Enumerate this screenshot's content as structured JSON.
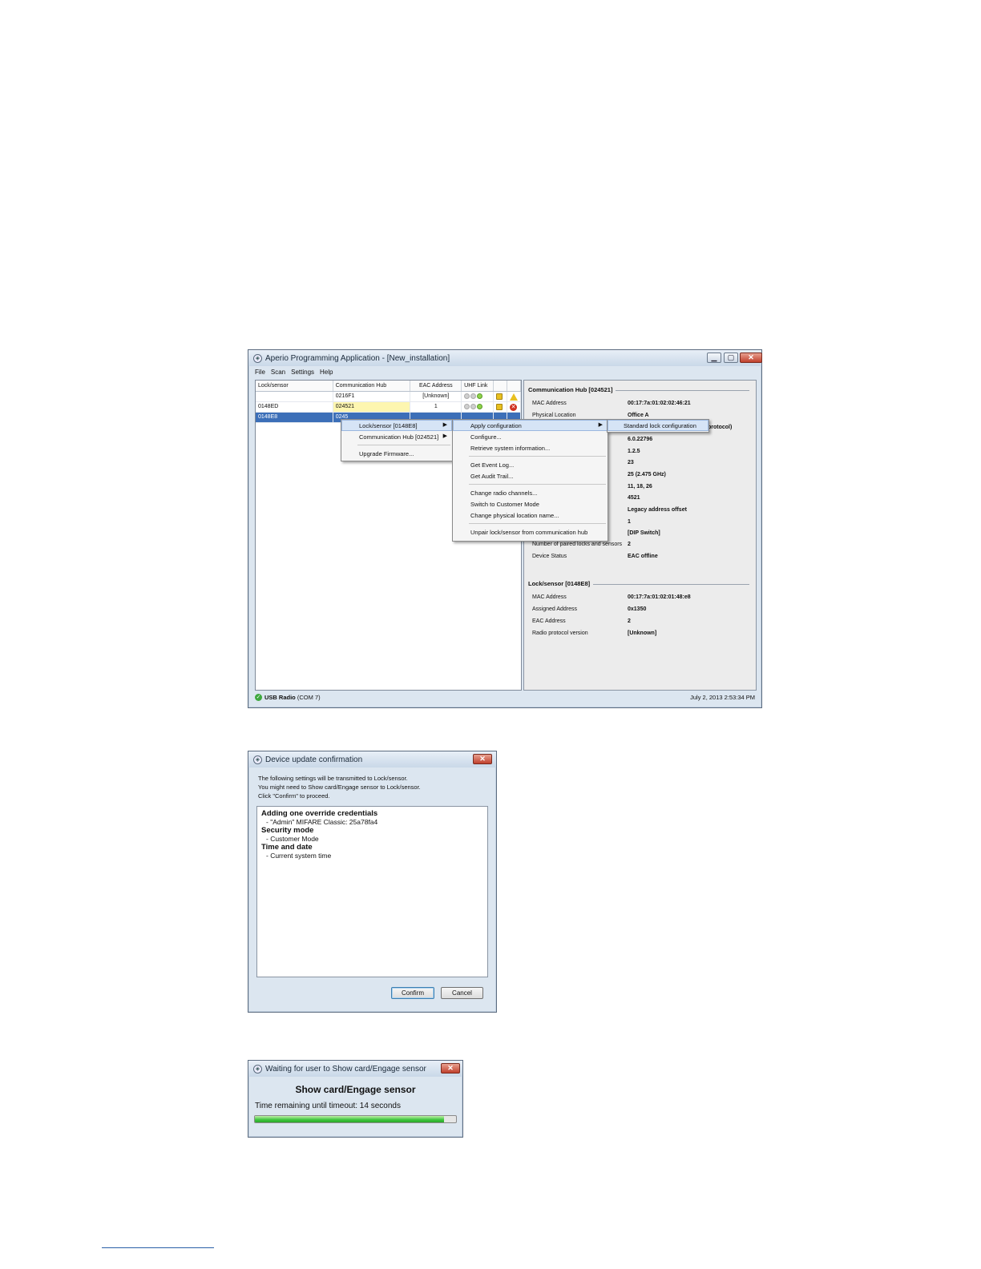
{
  "main_window": {
    "title": "Aperio Programming Application - [New_installation]",
    "menu": [
      "File",
      "Scan",
      "Settings",
      "Help"
    ],
    "table": {
      "columns": [
        "Lock/sensor",
        "Communication Hub",
        "EAC Address",
        "UHF Link",
        "",
        ""
      ],
      "rows": [
        {
          "lock": "",
          "hub": "0216F1",
          "eac": "[Unknown]"
        },
        {
          "lock": "0148ED",
          "hub": "024521",
          "eac": "1"
        },
        {
          "lock": "0148E8",
          "hub": "0245",
          "eac": ""
        }
      ]
    },
    "context_menu": {
      "items": [
        "Lock/sensor [0148E8]",
        "Communication Hub [024521]",
        "Upgrade Firmware..."
      ]
    },
    "submenu": {
      "items": [
        "Apply configuration",
        "Configure...",
        "Retrieve system information...",
        "Get Event Log...",
        "Get Audit Trail...",
        "Change radio channels...",
        "Switch to Customer Mode",
        "Change physical location name...",
        "Unpair lock/sensor from communication hub"
      ]
    },
    "submenu2": {
      "items": [
        "Standard lock configuration"
      ]
    },
    "hub_section": {
      "title": "Communication Hub [024521]",
      "mac_label": "MAC Address",
      "mac_value": "00:17:7a:01:02:02:46:21",
      "location_label": "Physical Location",
      "location_value": "Office A",
      "protocol_value_fragment": "protocol)",
      "values": [
        "6.0.22796",
        "1.2.5",
        "23",
        "25 (2.475 GHz)",
        "11, 18, 26",
        "4521",
        "Legacy address offset",
        "1",
        "[DIP Switch]"
      ],
      "paired_label": "Number of paired locks and sensors",
      "paired_value": "2",
      "status_label": "Device Status",
      "status_value": "EAC offline"
    },
    "lock_section": {
      "title": "Lock/sensor [0148E8]",
      "rows": [
        {
          "label": "MAC Address",
          "value": "00:17:7a:01:02:01:48:e8"
        },
        {
          "label": "Assigned Address",
          "value": "0x1350"
        },
        {
          "label": "EAC Address",
          "value": "2"
        },
        {
          "label": "Radio protocol version",
          "value": "[Unknown]"
        }
      ]
    },
    "status": {
      "connection_bold": "USB Radio",
      "connection_port": "(COM 7)",
      "datetime": "July 2, 2013 2:53:34 PM"
    }
  },
  "confirm_dialog": {
    "title": "Device update confirmation",
    "intro": [
      "The following settings will be transmitted to Lock/sensor.",
      "You might need to Show card/Engage sensor to Lock/sensor.",
      "Click \"Confirm\" to proceed."
    ],
    "content": [
      {
        "heading": "Adding one override credentials",
        "item": "- \"Admin\" MIFARE Classic: 25a78fa4"
      },
      {
        "heading": "Security mode",
        "item": "- Customer Mode"
      },
      {
        "heading": "Time and date",
        "item": "- Current system time"
      }
    ],
    "confirm_label": "Confirm",
    "cancel_label": "Cancel"
  },
  "wait_dialog": {
    "title": "Waiting for user to Show card/Engage sensor",
    "heading": "Show card/Engage sensor",
    "timeout_label": "Time remaining until timeout:",
    "timeout_value": "14 seconds",
    "progress_fraction": 0.94
  },
  "colors": {
    "selection": "#3c6fb8",
    "highlight": "#fdf6b0",
    "progress": "#3cc43c",
    "close_button": "#c0402c"
  }
}
